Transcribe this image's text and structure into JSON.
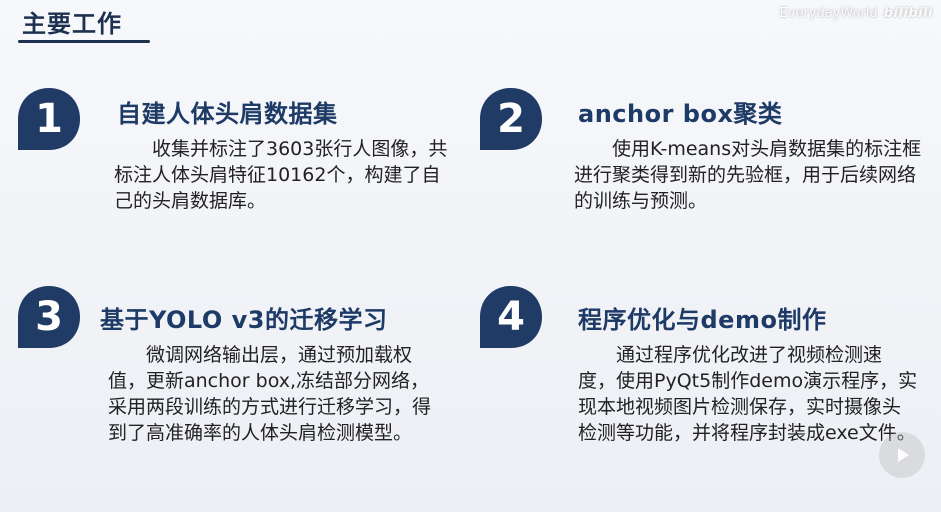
{
  "slide": {
    "title": "主要工作",
    "watermark": {
      "text": "EverydayWorld",
      "logo": "bilibili"
    },
    "items": [
      {
        "number": "1",
        "title": "自建人体头肩数据集",
        "text": "收集并标注了3603张行人图像，共标注人体头肩特征10162个，构建了自己的头肩数据库。"
      },
      {
        "number": "2",
        "title": "anchor box聚类",
        "text": "使用K-means对头肩数据集的标注框进行聚类得到新的先验框，用于后续网络的训练与预测。"
      },
      {
        "number": "3",
        "title": "基于YOLO v3的迁移学习",
        "text": "微调网络输出层，通过预加载权值，更新anchor box,冻结部分网络，采用两段训练的方式进行迁移学习，得到了高准确率的人体头肩检测模型。"
      },
      {
        "number": "4",
        "title": "程序优化与demo制作",
        "text": "通过程序优化改进了视频检测速度，使用PyQt5制作demo演示程序，实现本地视频图片检测保存，实时摄像头检测等功能，并将程序封装成exe文件。"
      }
    ]
  },
  "colors": {
    "badge": "#1f3b66",
    "title": "#1e3a66",
    "body_text": "#222222"
  },
  "icons": {
    "play": "play-icon"
  }
}
